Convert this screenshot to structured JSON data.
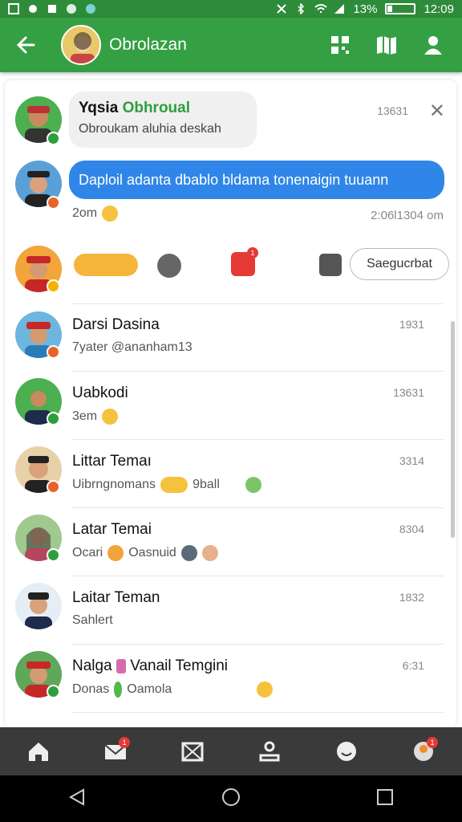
{
  "status_bar": {
    "battery": "13%",
    "time": "12:09"
  },
  "header": {
    "title": "Obrolazan"
  },
  "top_message": {
    "sender_plain": "Yqsia ",
    "sender_accent": "Obhroual",
    "text": "Obroukam aluhia deskah",
    "time": "13631"
  },
  "blue_message": {
    "text": "Daploil adanta dbablo bldama tonenaigin tuuann",
    "sub": "2om",
    "time": "2:06l1304 om"
  },
  "reaction_row": {
    "button_label": "Saegucrbat",
    "notif_count": "1"
  },
  "chats": [
    {
      "name": "Darsi Dasina",
      "message": "7yater @ananham13",
      "time": "1931"
    },
    {
      "name": "Uabkodi",
      "message": "3em",
      "time": "13631"
    },
    {
      "name": "Littar Temaı",
      "message": "Uibrngnomans",
      "message_tail": "9ball",
      "time": "3314"
    },
    {
      "name": "Latar Temai",
      "message": "Ocari",
      "message_tail": "Oasnuid",
      "time": "8304"
    },
    {
      "name": "Laitar Teman",
      "message": "Sahlert",
      "time": "1832"
    },
    {
      "name": "Nalga",
      "name_tail": "Vanail Temgini",
      "message": "Donas",
      "message_tail": "Oamola",
      "time": "6:31"
    }
  ],
  "bottom_nav": {
    "mail_badge": "1",
    "profile_badge": "1"
  },
  "colors": {
    "green": "#34a043",
    "blue": "#2f86e8"
  }
}
